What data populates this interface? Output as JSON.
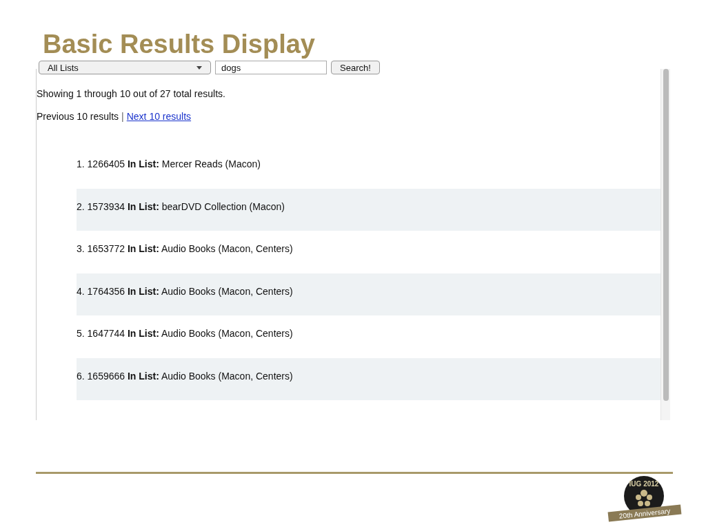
{
  "slide_title": "Basic Results Display",
  "search": {
    "list_select": "All Lists",
    "query": "dogs",
    "button": "Search!"
  },
  "summary": "Showing 1 through 10 out of 27 total results.",
  "pager": {
    "previous": "Previous 10 results",
    "separator": "|",
    "next": "Next 10 results"
  },
  "results": [
    {
      "number": "1.",
      "id": "1266405",
      "label": "In List:",
      "list": "Mercer Reads (Macon)",
      "shaded": false
    },
    {
      "number": "2.",
      "id": "1573934",
      "label": "In List:",
      "list": "bearDVD Collection (Macon)",
      "shaded": true
    },
    {
      "number": "3.",
      "id": "1653772",
      "label": "In List:",
      "list": "Audio Books (Macon, Centers)",
      "shaded": false
    },
    {
      "number": "4.",
      "id": "1764356",
      "label": "In List:",
      "list": "Audio Books (Macon, Centers)",
      "shaded": true
    },
    {
      "number": "5.",
      "id": "1647744",
      "label": "In List:",
      "list": "Audio Books (Macon, Centers)",
      "shaded": false
    },
    {
      "number": "6.",
      "id": "1659666",
      "label": "In List:",
      "list": "Audio Books (Macon, Centers)",
      "shaded": true
    }
  ],
  "logo": {
    "title": "IUG 2012",
    "ribbon": "20th Anniversary"
  }
}
